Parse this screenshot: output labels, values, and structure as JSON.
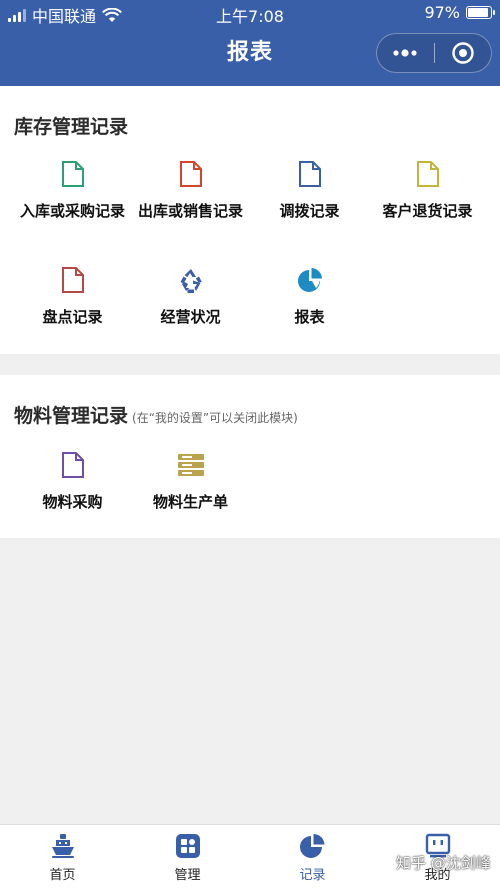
{
  "status_bar": {
    "carrier": "中国联通",
    "time": "上午7:08",
    "battery": "97%",
    "battery_level": 0.97
  },
  "header": {
    "title": "报表",
    "more_icon": "more-dots-icon",
    "close_icon": "target-circle-icon"
  },
  "inventory": {
    "title": "库存管理记录",
    "items": [
      {
        "label": "入库或采购记录",
        "icon": "document-icon",
        "color": "#2e9e74"
      },
      {
        "label": "出库或销售记录",
        "icon": "document-icon",
        "color": "#d6452b"
      },
      {
        "label": "调拨记录",
        "icon": "document-icon",
        "color": "#3a5fa9"
      },
      {
        "label": "客户退货记录",
        "icon": "document-icon",
        "color": "#c4b43a"
      },
      {
        "label": "盘点记录",
        "icon": "document-icon",
        "color": "#b34a45"
      },
      {
        "label": "经营状况",
        "icon": "recycle-icon",
        "color": "#3a5fa9"
      },
      {
        "label": "报表",
        "icon": "pie-chart-icon",
        "color": "#1e8bc3"
      }
    ]
  },
  "material": {
    "title": "物料管理记录",
    "subtitle": "(在“我的设置”可以关闭此模块)",
    "items": [
      {
        "label": "物料采购",
        "icon": "document-icon",
        "color": "#6f4fa5"
      },
      {
        "label": "物料生产单",
        "icon": "stack-icon",
        "color": "#b9a44d"
      }
    ]
  },
  "tabbar": {
    "tabs": [
      {
        "label": "首页",
        "icon": "ship-icon"
      },
      {
        "label": "管理",
        "icon": "grid-icon"
      },
      {
        "label": "记录",
        "icon": "pie-chart-icon",
        "active": true
      },
      {
        "label": "我的",
        "icon": "face-icon"
      }
    ]
  },
  "watermark": "知乎 @沈剑峰",
  "colors": {
    "header": "#3a5fa9",
    "active_tab": "#3a5fa9",
    "background": "#f0f0f0"
  }
}
